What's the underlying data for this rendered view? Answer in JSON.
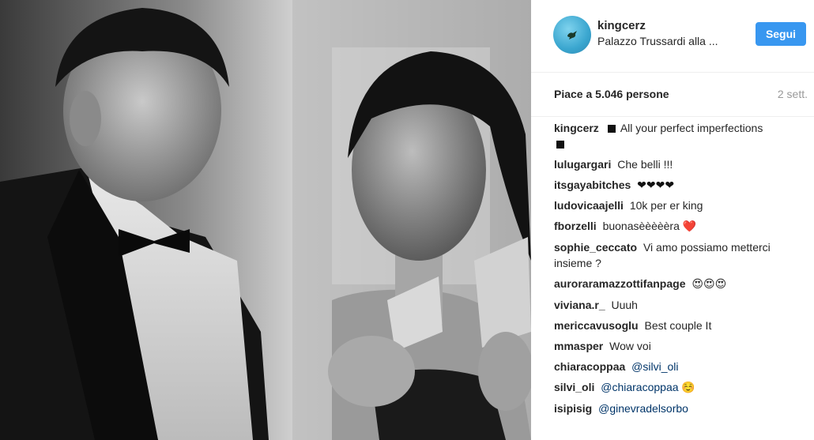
{
  "post": {
    "username": "kingcerz",
    "location": "Palazzo Trussardi alla ...",
    "follow_label": "Segui",
    "likes": "Piace a 5.046 persone",
    "time": "2 sett."
  },
  "comments": [
    {
      "user": "kingcerz",
      "text": "All your perfect imperfections"
    },
    {
      "user": "lulugargari",
      "text": "Che belli !!!"
    },
    {
      "user": "itsgayabitches",
      "text": "❤❤❤❤"
    },
    {
      "user": "ludovicaajelli",
      "text": "10k per er king"
    },
    {
      "user": "fborzelli",
      "text": "buonasèèèèèra",
      "emoji": "❤️"
    },
    {
      "user": "sophie_ceccato",
      "text": "Vi amo possiamo metterci insieme ?"
    },
    {
      "user": "aurorarамazzottifanpage",
      "text": "😍😍😍"
    },
    {
      "user": "viviana.r_",
      "text": "Uuuh"
    },
    {
      "user": "mericcavusoglu",
      "text": "Best couple It"
    },
    {
      "user": "mmasper",
      "text": "Wow voi"
    },
    {
      "user": "chiaracoppaa",
      "mention": "@silvi_oli"
    },
    {
      "user": "silvi_oli",
      "mention": "@chiaracoppaa",
      "emoji": "☺️"
    },
    {
      "user": "isipisig",
      "mention": "@ginevradelsorbo"
    }
  ],
  "colors": {
    "follow_button": "#3897f0",
    "mention": "#003569",
    "heart": "#ed4956",
    "muted": "#999999"
  },
  "icons": {
    "avatar": "bird-avatar-icon",
    "square": "black-square-icon"
  }
}
